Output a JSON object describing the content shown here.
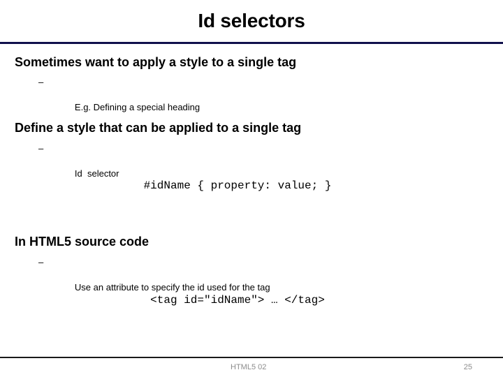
{
  "slide": {
    "title": "Id selectors",
    "accent_color": "#11114c",
    "footer_rule_color": "#1a1a1a",
    "footer_text_color": "#8c8c8c",
    "background_color": "#ffffff",
    "text_color": "#000000"
  },
  "body": {
    "sections": [
      {
        "heading": "Sometimes want to apply a style to a single tag",
        "bullet_marker": "–",
        "sub_bullets": [
          "E.g. Defining a special heading"
        ]
      },
      {
        "heading": "Define a style that can be applied to a single tag",
        "bullet_marker": "–",
        "sub_bullets": [
          "Id  selector"
        ]
      },
      {
        "heading": "In HTML5 source code",
        "bullet_marker": "–",
        "sub_bullets": [
          "Use an attribute to specify the id used for the tag"
        ]
      }
    ],
    "code_samples": [
      "#idName { property: value; }",
      "<tag id=\"idName\"> … </tag>"
    ]
  },
  "footer": {
    "label": "HTML5 02",
    "page_number": "25"
  }
}
